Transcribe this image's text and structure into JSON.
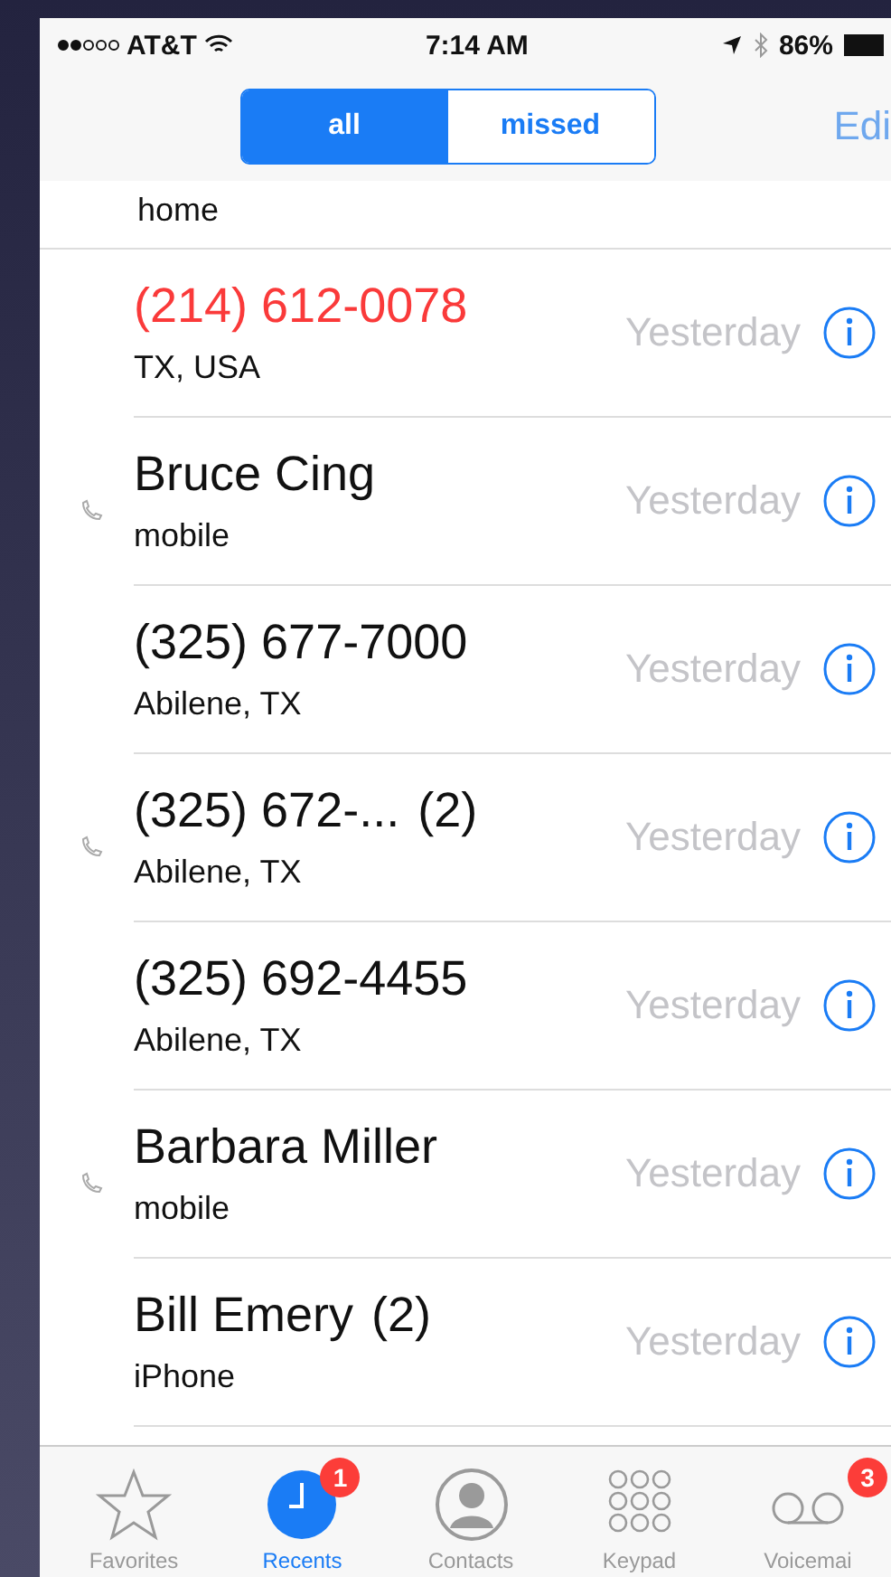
{
  "status_bar": {
    "carrier": "AT&T",
    "time": "7:14 AM",
    "battery": "86%"
  },
  "segments": [
    {
      "label": "all",
      "selected": true
    },
    {
      "label": "missed",
      "selected": false
    }
  ],
  "edit": "Edi",
  "partial_row": {
    "detail": "home"
  },
  "calls": [
    {
      "name": "(214) 612-0078",
      "missed": true,
      "outgoing": false,
      "detail": "TX, USA",
      "time": "Yesterday"
    },
    {
      "name": "Bruce Cing",
      "missed": false,
      "outgoing": true,
      "detail": "mobile",
      "time": "Yesterday"
    },
    {
      "name": "(325) 677-7000",
      "missed": false,
      "outgoing": false,
      "detail": "Abilene, TX",
      "time": "Yesterday"
    },
    {
      "name": "(325) 672-...",
      "count": "(2)",
      "missed": false,
      "outgoing": true,
      "detail": "Abilene, TX",
      "time": "Yesterday"
    },
    {
      "name": "(325) 692-4455",
      "missed": false,
      "outgoing": false,
      "detail": "Abilene, TX",
      "time": "Yesterday"
    },
    {
      "name": "Barbara Miller",
      "missed": false,
      "outgoing": true,
      "detail": "mobile",
      "time": "Yesterday"
    },
    {
      "name": "Bill Emery",
      "count": "(2)",
      "missed": false,
      "outgoing": false,
      "detail": "iPhone",
      "time": "Yesterday"
    }
  ],
  "tabs": [
    {
      "kind": "star",
      "label": "Favorites",
      "selected": false
    },
    {
      "kind": "clock",
      "label": "Recents",
      "selected": true,
      "badge": "1"
    },
    {
      "kind": "person",
      "label": "Contacts",
      "selected": false
    },
    {
      "kind": "keypad",
      "label": "Keypad",
      "selected": false
    },
    {
      "kind": "voicemail",
      "label": "Voicemai",
      "selected": false,
      "badge": "3"
    }
  ]
}
